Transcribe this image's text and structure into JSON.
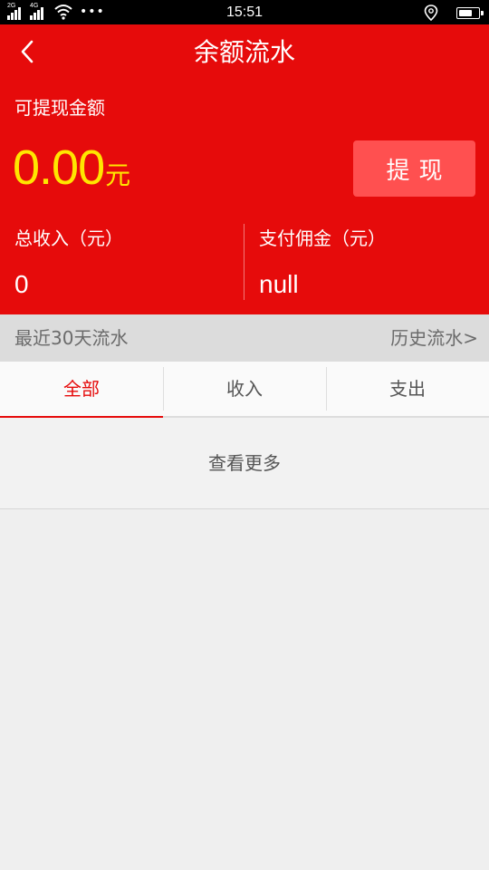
{
  "status_bar": {
    "sim1_network": "2G",
    "sim2_network": "4G",
    "more_indicator": "•••",
    "time": "15:51",
    "battery_level": 0.75
  },
  "header": {
    "title": "余额流水",
    "available_label": "可提现金额",
    "available_amount": "0.00",
    "currency_unit": "元",
    "withdraw_label": "提现"
  },
  "stats": {
    "total_income_label": "总收入（元）",
    "total_income_value": "0",
    "commission_label": "支付佣金（元）",
    "commission_value": "null"
  },
  "recent": {
    "title": "最近30天流水",
    "history_link": "历史流水>"
  },
  "tabs": [
    {
      "label": "全部",
      "active": true
    },
    {
      "label": "收入",
      "active": false
    },
    {
      "label": "支出",
      "active": false
    }
  ],
  "view_more_label": "查看更多",
  "colors": {
    "primary_red": "#e60b0b",
    "amount_yellow": "#ffe600",
    "withdraw_button": "#ff5050",
    "background": "#efefef"
  },
  "icons": {
    "back": "chevron-left-icon",
    "wifi": "wifi-icon",
    "location": "location-pin-icon",
    "battery": "battery-icon"
  }
}
